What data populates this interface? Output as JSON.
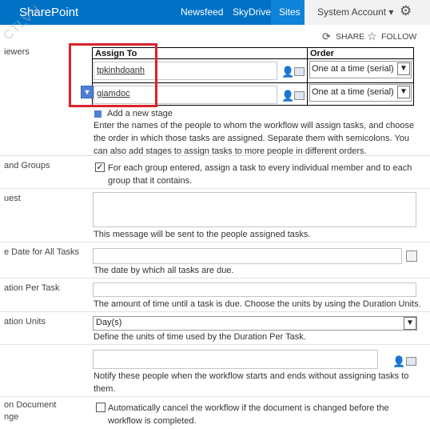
{
  "suitebar": {
    "brand": "SharePoint",
    "nav": [
      "Newsfeed",
      "SkyDrive",
      "Sites"
    ],
    "account": "System Account ▾",
    "accent": "#0072c6"
  },
  "actions": {
    "share": "SHARE",
    "follow": "FOLLOW"
  },
  "watermark": "CTLVN",
  "labels": {
    "reviewers": "iewers",
    "groups": "and Groups",
    "request": "uest",
    "due_date": "e Date for All Tasks",
    "duration": "ation Per Task",
    "duration_units": "ation Units",
    "cancel_line1": "on Document",
    "cancel_line2": "nge"
  },
  "assign": {
    "col_assign": "Assign To",
    "col_order": "Order",
    "rows": [
      {
        "person": "tpkinhdoanh",
        "order": "One at a time (serial)"
      },
      {
        "person": "giamdoc",
        "order": "One at a time (serial)"
      }
    ],
    "add_stage": "Add a new stage",
    "help": "Enter the names of the people to whom the workflow will assign tasks, and choose the order in which those tasks are assigned. Separate them with semicolons. You can also add stages to assign tasks to more people in different orders."
  },
  "groups": {
    "checked": true,
    "text": "For each group entered, assign a task to every individual member and to each group that it contains."
  },
  "request": {
    "help": "This message will be sent to the people assigned tasks."
  },
  "due_date": {
    "help": "The date by which all tasks are due."
  },
  "duration": {
    "help": "The amount of time until a task is due. Choose the units by using the Duration Units."
  },
  "duration_units": {
    "value": "Day(s)",
    "help": "Define the units of time used by the Duration Per Task."
  },
  "cc": {
    "help": "Notify these people when the workflow starts and ends without assigning tasks to them."
  },
  "cancel": {
    "checked": false,
    "text": "Automatically cancel the workflow if the document is changed before the workflow is completed."
  }
}
